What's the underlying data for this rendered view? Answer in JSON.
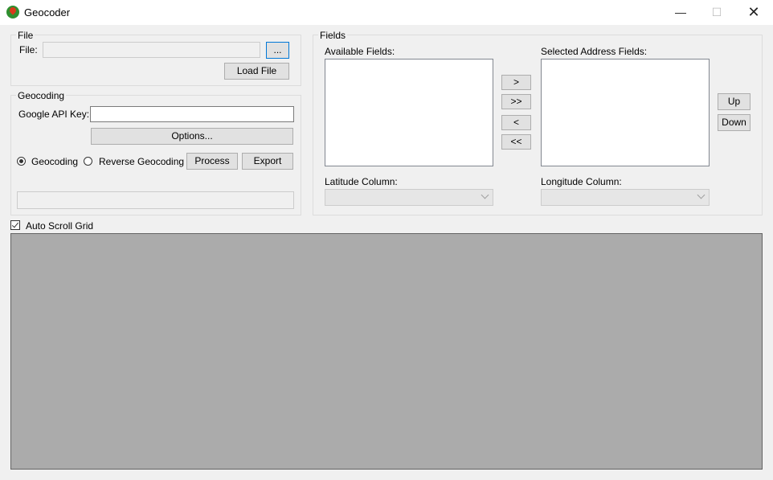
{
  "window": {
    "title": "Geocoder",
    "min": "—",
    "max": "☐",
    "close": "✕"
  },
  "file_group": {
    "label": "File",
    "file_label": "File:",
    "file_value": "",
    "browse_label": "...",
    "load_label": "Load File"
  },
  "geocoding_group": {
    "label": "Geocoding",
    "api_key_label": "Google API Key:",
    "api_key_value": "",
    "options_label": "Options...",
    "radio_geocoding": "Geocoding",
    "radio_reverse": "Reverse Geocoding",
    "selected_mode": "Geocoding",
    "process_label": "Process",
    "export_label": "Export",
    "status_value": ""
  },
  "fields_group": {
    "label": "Fields",
    "available_label": "Available Fields:",
    "available_items": [],
    "selected_label": "Selected Address Fields:",
    "selected_items": [],
    "add_one": ">",
    "add_all": ">>",
    "remove_one": "<",
    "remove_all": "<<",
    "up_label": "Up",
    "down_label": "Down",
    "lat_label": "Latitude Column:",
    "lat_value": "",
    "lon_label": "Longitude Column:",
    "lon_value": ""
  },
  "auto_scroll": {
    "label": "Auto Scroll Grid",
    "checked": true
  },
  "colors": {
    "accent": "#0078d7",
    "grid_bg": "#ababab",
    "window_bg": "#f0f0f0"
  }
}
